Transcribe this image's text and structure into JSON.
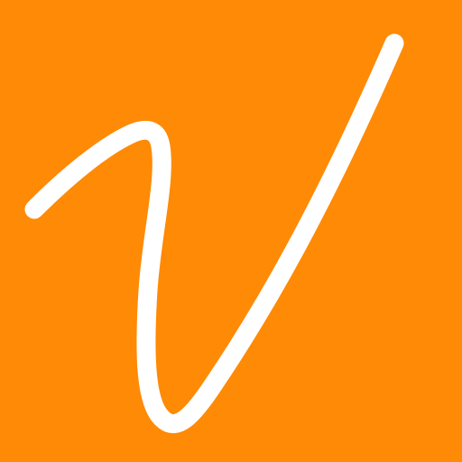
{
  "icon": {
    "name": "v-logo-icon",
    "background_color": "#FF8A05",
    "glyph_color": "#FFFFFF"
  }
}
